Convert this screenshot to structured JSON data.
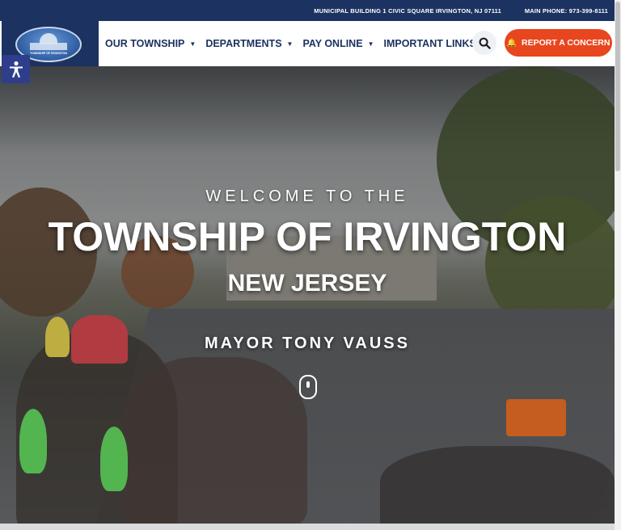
{
  "topbar": {
    "address": "MUNICIPAL BUILDING 1 CIVIC SQUARE IRVINGTON, NJ 07111",
    "phone": "MAIN PHONE: 973-399-8111"
  },
  "logo": {
    "text": "TOWNSHIP OF IRVINGTON"
  },
  "nav": {
    "items": [
      {
        "label": "OUR TOWNSHIP"
      },
      {
        "label": "DEPARTMENTS"
      },
      {
        "label": "PAY ONLINE"
      },
      {
        "label": "IMPORTANT LINKS"
      }
    ],
    "report_label": "REPORT A CONCERN"
  },
  "hero": {
    "welcome": "WELCOME TO THE",
    "title": "TOWNSHIP OF IRVINGTON",
    "state": "NEW JERSEY",
    "mayor": "MAYOR TONY VAUSS"
  },
  "icons": {
    "search": "search-icon",
    "bell": "bell-icon",
    "accessibility": "accessibility-icon",
    "caret": "chevron-down-icon",
    "scroll": "scroll-down-icon"
  },
  "colors": {
    "navy": "#1c3260",
    "accent": "#e8461e",
    "accessibility": "#2e3e8c"
  }
}
